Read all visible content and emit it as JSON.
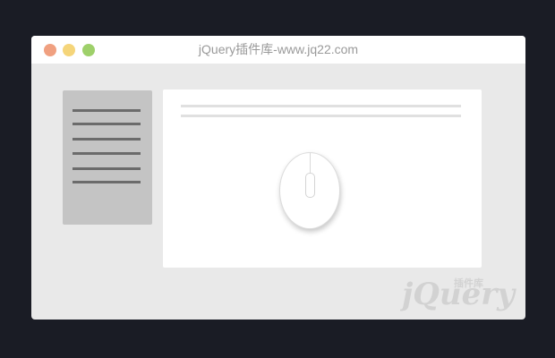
{
  "window": {
    "title": "jQuery插件库-www.jq22.com",
    "controls": {
      "close": {
        "color": "#f0a080"
      },
      "minimize": {
        "color": "#f5d57a"
      },
      "maximize": {
        "color": "#9ed06a"
      }
    }
  },
  "sidebar": {
    "item_count": 6
  },
  "content": {
    "line_count": 2,
    "illustration": "mouse-icon"
  },
  "watermark": {
    "text": "jQuery",
    "subtext": "插件库"
  }
}
